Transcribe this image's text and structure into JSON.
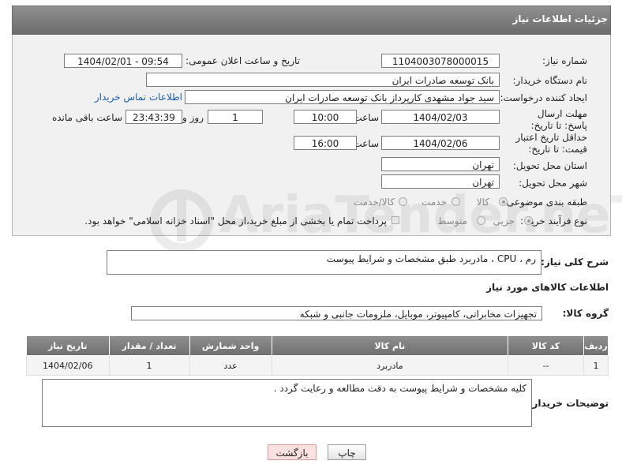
{
  "panel": {
    "title": "جزئیات اطلاعات نیاز"
  },
  "fields": {
    "need_number_label": "شماره نیاز:",
    "need_number": "1104003078000015",
    "announce_label": "تاریخ و ساعت اعلان عمومی:",
    "announce_value": "1404/02/01 - 09:54",
    "buyer_org_label": "نام دستگاه خریدار:",
    "buyer_org": "بانک توسعه صادرات ایران",
    "creator_label": "ایجاد کننده درخواست:",
    "creator": "سید جواد مشهدی کارپرداز بانک توسعه صادرات ایران",
    "contact_link": "اطلاعات تماس خریدار",
    "reply_deadline_label": "مهلت ارسال پاسخ: تا تاریخ:",
    "reply_date": "1404/02/03",
    "time_label": "ساعت",
    "reply_time": "10:00",
    "days_value": "1",
    "days_label": "روز و",
    "remaining_time": "23:43:39",
    "remaining_label": "ساعت باقی مانده",
    "validity_label": "حداقل تاریخ اعتبار قیمت: تا تاریخ:",
    "validity_date": "1404/02/06",
    "validity_time": "16:00",
    "province_label": "استان محل تحویل:",
    "province": "تهران",
    "city_label": "شهر محل تحویل:",
    "city": "تهران",
    "category_label": "طبقه بندی موضوعی:",
    "category_options": [
      "کالا",
      "خدمت",
      "کالا/خدمت"
    ],
    "purchase_type_label": "نوع فرآیند خرید :",
    "purchase_options": [
      "جزیی",
      "متوسط"
    ],
    "payment_note": "پرداخت تمام یا بخشی از مبلغ خرید،از محل \"اسناد خزانه اسلامی\" خواهد بود."
  },
  "description": {
    "label": "شرح کلی نیاز:",
    "value": "رم  ، CPU ، مادربرد  طبق مشخصات و شرایط پیوست"
  },
  "goods_section": {
    "title": "اطلاعات کالاهای مورد نیاز",
    "group_label": "گروه کالا:",
    "group_value": "تجهیزات مخابراتی، کامپیوتر، موبایل، ملزومات جانبی و شبکه"
  },
  "table": {
    "headers": [
      "ردیف",
      "کد کالا",
      "نام کالا",
      "واحد شمارش",
      "تعداد / مقدار",
      "تاریخ نیاز"
    ],
    "rows": [
      [
        "1",
        "--",
        "مادربرد",
        "عدد",
        "1",
        "1404/02/06"
      ]
    ]
  },
  "buyer_notes": {
    "label": "توضیحات خریدار:",
    "value": "کلیه مشخصات و شرایط پیوست به دقت مطالعه و رعایت گردد ."
  },
  "buttons": {
    "print": "چاپ",
    "back": "بازگشت"
  },
  "watermark": "AriaTender.neT"
}
